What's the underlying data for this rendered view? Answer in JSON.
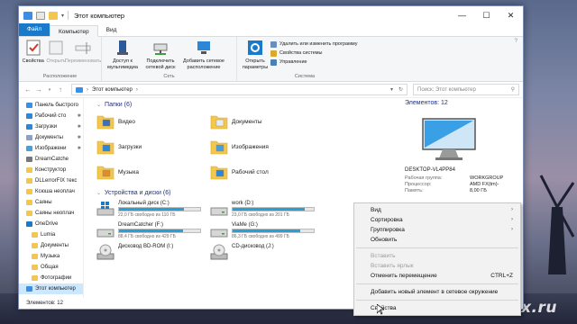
{
  "titlebar": {
    "title": "Этот компьютер",
    "minimize": "—",
    "maximize": "☐",
    "close": "✕"
  },
  "ribbon_tabs": [
    "Файл",
    "Компьютер",
    "Вид"
  ],
  "ribbon": {
    "location_group": {
      "label": "Расположение",
      "buttons": [
        "Свойства",
        "Открыть",
        "Переименовать"
      ]
    },
    "network_group": {
      "label": "Сеть",
      "buttons": [
        "Доступ к мультимедиа",
        "Подключить сетевой диск",
        "Добавить сетевое расположение"
      ]
    },
    "system_group": {
      "label": "Система",
      "open_settings": "Открыть параметры",
      "items": [
        "Удалить или изменить программу",
        "Свойства системы",
        "Управление"
      ]
    }
  },
  "address": {
    "path": "Этот компьютер",
    "search_placeholder": "Поиск: Этот компьютер"
  },
  "sidebar": {
    "items": [
      {
        "label": "Панель быстрого",
        "type": "quick",
        "pinned": false
      },
      {
        "label": "Рабочий сто",
        "type": "desktop",
        "pinned": true
      },
      {
        "label": "Загрузки",
        "type": "downloads",
        "pinned": true
      },
      {
        "label": "Документы",
        "type": "docs",
        "pinned": true
      },
      {
        "label": "Изображени",
        "type": "pics",
        "pinned": true
      },
      {
        "label": "DreamCatche",
        "type": "drive",
        "pinned": false
      },
      {
        "label": "Конструктор",
        "type": "folder",
        "pinned": false
      },
      {
        "label": "DLLerrorFIX текс",
        "type": "folder",
        "pinned": false
      },
      {
        "label": "Ксюша неоплач",
        "type": "folder",
        "pinned": false
      },
      {
        "label": "Саяны",
        "type": "folder",
        "pinned": false
      },
      {
        "label": "Саяны неоплач",
        "type": "folder",
        "pinned": false
      },
      {
        "label": "OneDrive",
        "type": "onedrive",
        "pinned": false
      },
      {
        "label": "Lumia",
        "type": "folder",
        "pinned": false
      },
      {
        "label": "Документы",
        "type": "folder",
        "pinned": false
      },
      {
        "label": "Музыка",
        "type": "folder",
        "pinned": false
      },
      {
        "label": "Общая",
        "type": "folder",
        "pinned": false
      },
      {
        "label": "Фотографии",
        "type": "folder",
        "pinned": false
      },
      {
        "label": "Этот компьютер",
        "type": "pc",
        "pinned": false
      }
    ],
    "pin_glyph": "✱"
  },
  "folders_section": {
    "header": "Папки (6)",
    "items": [
      {
        "label": "Видео",
        "kind": "video"
      },
      {
        "label": "Документы",
        "kind": "docs"
      },
      {
        "label": "Загрузки",
        "kind": "downloads"
      },
      {
        "label": "Изображения",
        "kind": "pics"
      },
      {
        "label": "Музыка",
        "kind": "music"
      },
      {
        "label": "Рабочий стол",
        "kind": "desktop"
      }
    ]
  },
  "drives_section": {
    "header": "Устройства и диски (6)",
    "items": [
      {
        "label": "Локальный диск (C:)",
        "free": "22,0 ГБ свободно из 110 ГБ",
        "used_fraction": 0.8,
        "kind": "windows"
      },
      {
        "label": "work (D:)",
        "free": "23,0 ГБ свободно из 201 ГБ",
        "used_fraction": 0.89,
        "kind": "hdd"
      },
      {
        "label": "DreamCatcher (F:)",
        "free": "88,4 ГБ свободно из 429 ГБ",
        "used_fraction": 0.79,
        "kind": "hdd"
      },
      {
        "label": "ViaMe (G:)",
        "free": "86,3 ГБ свободно из 499 ГБ",
        "used_fraction": 0.83,
        "kind": "hdd"
      },
      {
        "label": "Дисковод BD-ROM (I:)",
        "free": "",
        "used_fraction": null,
        "kind": "bd"
      },
      {
        "label": "CD-дисковод (J:)",
        "free": "",
        "used_fraction": null,
        "kind": "cd"
      }
    ]
  },
  "details": {
    "title": "Элементов: 12",
    "pc_name": "DESKTOP-VL4PP84",
    "rows": [
      {
        "k": "Рабочая группа:",
        "v": "WORKGROUP"
      },
      {
        "k": "Процессор:",
        "v": "AMD FX(tm)-"
      },
      {
        "k": "Память:",
        "v": "8,00 ГБ"
      }
    ]
  },
  "statusbar": {
    "text": "Элементов: 12"
  },
  "context_menu": {
    "items": [
      {
        "label": "Вид",
        "shortcut": "",
        "submenu": true,
        "disabled": false,
        "sep_after": false
      },
      {
        "label": "Сортировка",
        "shortcut": "",
        "submenu": true,
        "disabled": false,
        "sep_after": false
      },
      {
        "label": "Группировка",
        "shortcut": "",
        "submenu": true,
        "disabled": false,
        "sep_after": false
      },
      {
        "label": "Обновить",
        "shortcut": "",
        "submenu": false,
        "disabled": false,
        "sep_after": true
      },
      {
        "label": "Вставить",
        "shortcut": "",
        "submenu": false,
        "disabled": true,
        "sep_after": false
      },
      {
        "label": "Вставить ярлык",
        "shortcut": "",
        "submenu": false,
        "disabled": true,
        "sep_after": false
      },
      {
        "label": "Отменить перемещение",
        "shortcut": "CTRL+Z",
        "submenu": false,
        "disabled": false,
        "sep_after": true
      },
      {
        "label": "Добавить новый элемент в сетевое окружение",
        "shortcut": "",
        "submenu": false,
        "disabled": false,
        "sep_after": true
      },
      {
        "label": "Свойства",
        "shortcut": "",
        "submenu": false,
        "disabled": false,
        "sep_after": false
      }
    ]
  },
  "watermark": "DllErrorFix.ru",
  "colors": {
    "accent": "#1979ca",
    "folder_yellow": "#f3c74e",
    "drive_bar": "#26a0da"
  }
}
